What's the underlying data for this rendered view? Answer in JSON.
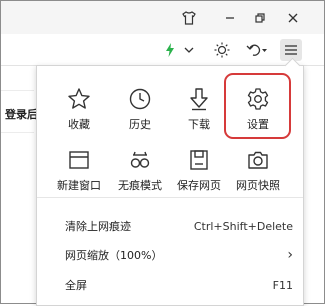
{
  "titlebar": {
    "shirt_icon": "shirt-icon",
    "min_symbol": "—",
    "restore_symbol": "❐",
    "close_symbol": "✕"
  },
  "toolbar": {
    "bolt": "⚡",
    "dropdown": "⌄",
    "undo_dropdown": "▾",
    "menu": "☰"
  },
  "page": {
    "label": "登录后"
  },
  "menu": {
    "grid": [
      {
        "label": "收藏",
        "icon": "star-icon"
      },
      {
        "label": "历史",
        "icon": "clock-icon"
      },
      {
        "label": "下载",
        "icon": "download-arrow-icon"
      },
      {
        "label": "设置",
        "icon": "gear-icon"
      },
      {
        "label": "新建窗口",
        "icon": "window-icon"
      },
      {
        "label": "无痕模式",
        "icon": "glasses-icon"
      },
      {
        "label": "保存网页",
        "icon": "save-icon"
      },
      {
        "label": "网页快照",
        "icon": "camera-icon"
      }
    ],
    "rows": [
      {
        "label": "清除上网痕迹",
        "shortcut": "Ctrl+Shift+Delete"
      },
      {
        "label": "网页缩放（100%）",
        "shortcut": "›"
      },
      {
        "label": "全屏",
        "shortcut": "F11"
      }
    ],
    "accent_color": "#d63a3a",
    "bolt_color": "#2bb24c"
  }
}
